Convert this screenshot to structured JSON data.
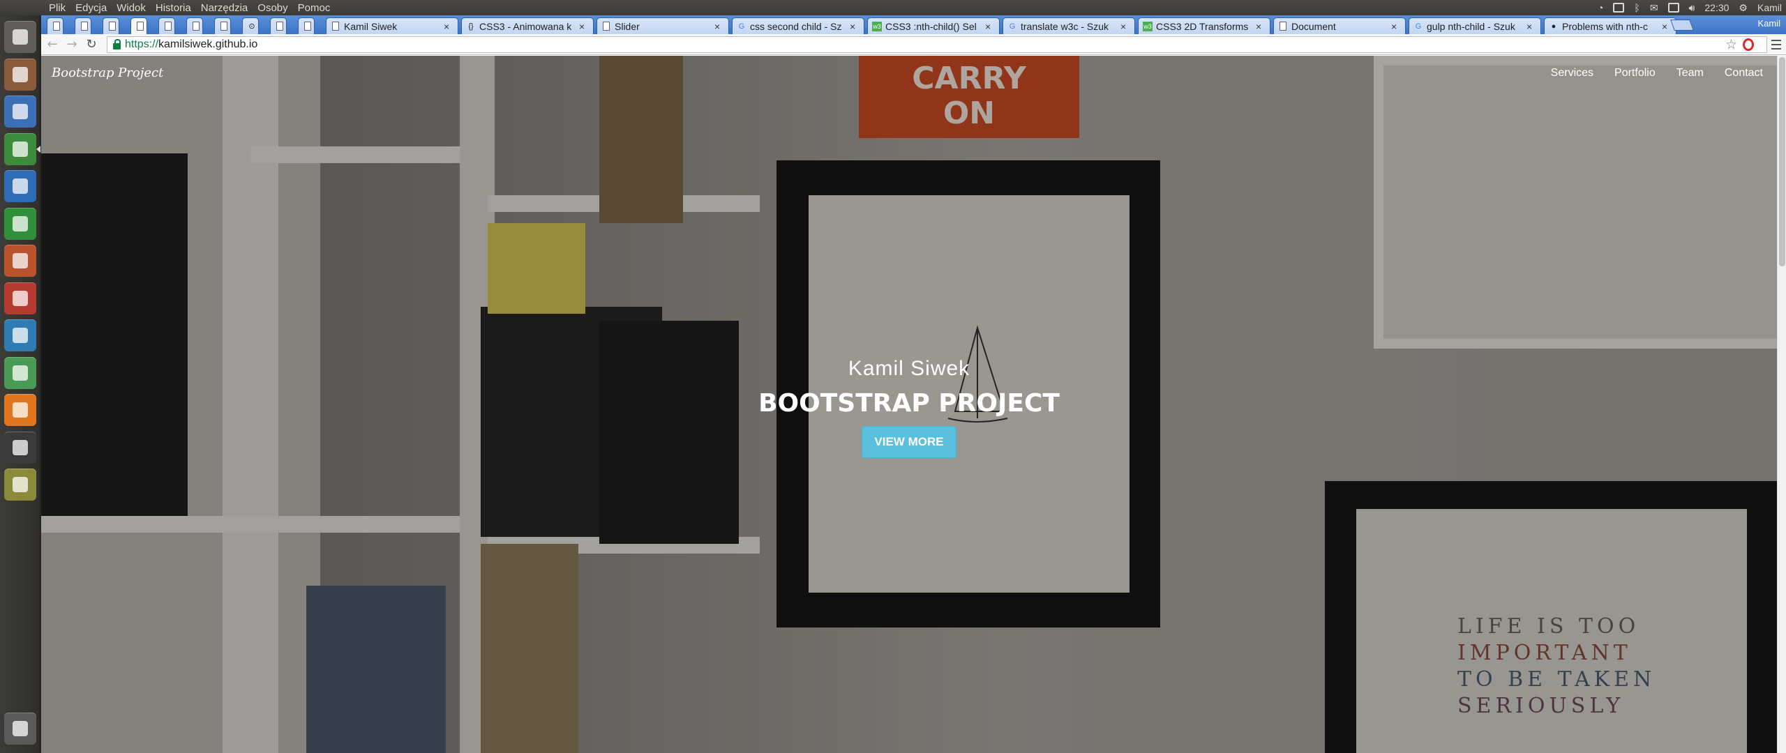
{
  "os_menu": [
    "Plik",
    "Edycja",
    "Widok",
    "Historia",
    "Narzędzia",
    "Osoby",
    "Pomoc"
  ],
  "tray": {
    "clock": "22:30",
    "user": "Kamil"
  },
  "launcher": [
    {
      "name": "ubuntu-dash-icon",
      "color": "#5f5e5a"
    },
    {
      "name": "files-icon",
      "color": "#8a5a3c"
    },
    {
      "name": "chromium-icon",
      "color": "#3c6fb5"
    },
    {
      "name": "chrome-icon",
      "color": "#3d8c3d"
    },
    {
      "name": "writer-icon",
      "color": "#2e6db5"
    },
    {
      "name": "calc-icon",
      "color": "#2f8f3a"
    },
    {
      "name": "impress-icon",
      "color": "#b8532d"
    },
    {
      "name": "system-settings-icon",
      "color": "#b53a2f"
    },
    {
      "name": "virtualbox-icon",
      "color": "#2f7cb5"
    },
    {
      "name": "atom-icon",
      "color": "#4a9a55"
    },
    {
      "name": "software-center-icon",
      "color": "#e0771f"
    },
    {
      "name": "terminal-icon",
      "color": "#3a3a3a"
    },
    {
      "name": "search-tool-icon",
      "color": "#8a8a3a"
    },
    {
      "name": "trash-icon",
      "color": "#5a5a5a"
    }
  ],
  "tabs": [
    {
      "title": "",
      "favicon": "doc"
    },
    {
      "title": "",
      "favicon": "doc"
    },
    {
      "title": "",
      "favicon": "doc"
    },
    {
      "title": "",
      "favicon": "doc",
      "active": true
    },
    {
      "title": "",
      "favicon": "doc"
    },
    {
      "title": "",
      "favicon": "doc"
    },
    {
      "title": "",
      "favicon": "doc"
    },
    {
      "title": "",
      "favicon": "gear"
    },
    {
      "title": "",
      "favicon": "doc"
    },
    {
      "title": "",
      "favicon": "doc"
    },
    {
      "title": "Kamil Siwek",
      "favicon": "doc"
    },
    {
      "title": "CSS3 - Animowana k",
      "favicon": "braces"
    },
    {
      "title": "Slider",
      "favicon": "doc"
    },
    {
      "title": "css second child - Sz",
      "favicon": "google"
    },
    {
      "title": "CSS3 :nth-child() Sel",
      "favicon": "w3"
    },
    {
      "title": "translate w3c - Szuk",
      "favicon": "google"
    },
    {
      "title": "CSS3 2D Transforms",
      "favicon": "w3"
    },
    {
      "title": "Document",
      "favicon": "doc"
    },
    {
      "title": "gulp nth-child - Szuk",
      "favicon": "google"
    },
    {
      "title": "Problems with nth-c",
      "favicon": "github"
    }
  ],
  "profile_name": "Kamil",
  "address": {
    "scheme": "https://",
    "host": "kamilsiwek.github.io"
  },
  "page": {
    "brand": "Bootstrap Project",
    "nav": [
      "Services",
      "Portfolio",
      "Team",
      "Contact"
    ],
    "hero_name": "Kamil Siwek",
    "hero_title": "BOOTSTRAP PROJECT",
    "hero_button": "VIEW MORE",
    "sign_text": "CARRY ON",
    "poster_text": [
      "LIFE IS TOO",
      "IMPORTANT",
      "TO BE TAKEN",
      "SERIOUSLY"
    ]
  },
  "colors": {
    "accent_button": "#5bc0de",
    "tab_strip": "#3c74c6",
    "secure_green": "#0b8043"
  }
}
